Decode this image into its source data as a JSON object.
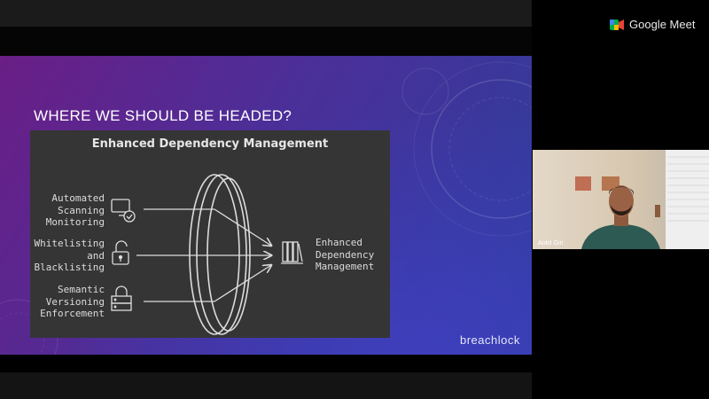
{
  "app": {
    "name": "Google Meet"
  },
  "slide": {
    "title": "WHERE WE SHOULD BE HEADED?",
    "brand": "breachlock",
    "diagram": {
      "title": "Enhanced Dependency Management",
      "inputs": [
        {
          "lines": [
            "Automated",
            "Scanning",
            "Monitoring"
          ],
          "icon": "monitor-check-icon"
        },
        {
          "lines": [
            "Whitelisting",
            "and",
            "Blacklisting"
          ],
          "icon": "padlock-open-icon"
        },
        {
          "lines": [
            "Semantic",
            "Versioning",
            "Enforcement"
          ],
          "icon": "padlock-server-icon"
        }
      ],
      "output": {
        "lines": [
          "Enhanced",
          "Dependency",
          "Management"
        ],
        "icon": "books-icon"
      }
    }
  },
  "participant": {
    "name": "Ankit Giri"
  },
  "colors": {
    "diagram_bg": "#353535",
    "slide_purple": "#6a1e86",
    "slide_blue": "#2b3f9c"
  }
}
